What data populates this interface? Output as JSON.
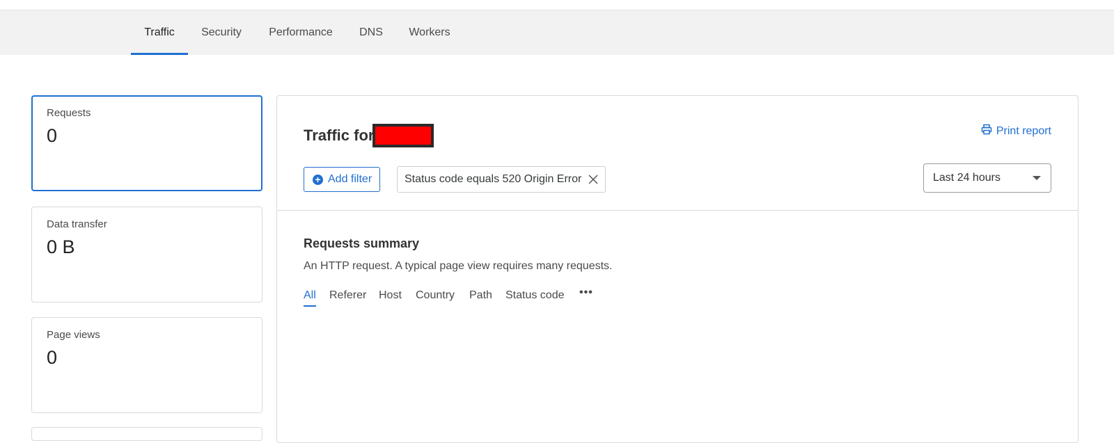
{
  "tabs": [
    {
      "label": "Traffic",
      "active": true
    },
    {
      "label": "Security",
      "active": false
    },
    {
      "label": "Performance",
      "active": false
    },
    {
      "label": "DNS",
      "active": false
    },
    {
      "label": "Workers",
      "active": false
    }
  ],
  "stats": [
    {
      "label": "Requests",
      "value": "0",
      "selected": true
    },
    {
      "label": "Data transfer",
      "value": "0 B",
      "selected": false
    },
    {
      "label": "Page views",
      "value": "0",
      "selected": false
    }
  ],
  "panel": {
    "title": "Traffic for",
    "print_label": "Print report",
    "add_filter_label": "Add filter",
    "filter_chip": "Status code equals 520 Origin Error",
    "time_range": "Last 24 hours"
  },
  "summary": {
    "title": "Requests summary",
    "description": "An HTTP request. A typical page view requires many requests.",
    "subtabs": [
      "All",
      "Referer",
      "Host",
      "Country",
      "Path",
      "Status code"
    ]
  },
  "colors": {
    "accent": "#1f6fd1",
    "redaction": "#ff0000"
  }
}
